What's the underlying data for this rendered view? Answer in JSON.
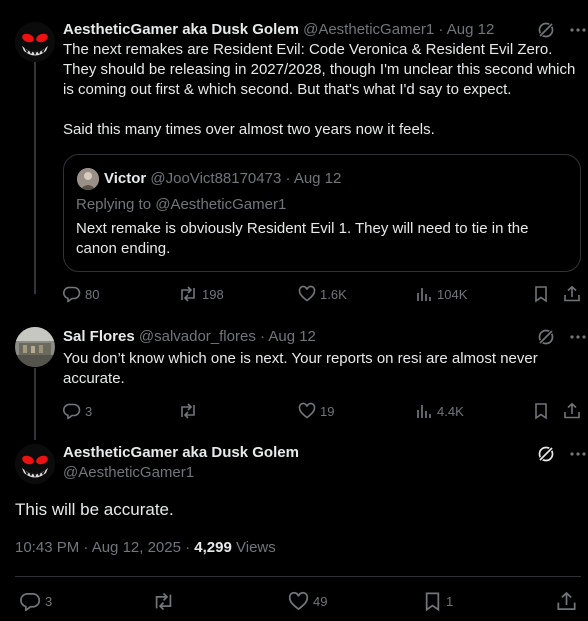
{
  "post1": {
    "author_name": "AestheticGamer aka Dusk Golem",
    "handle": "@AestheticGamer1",
    "date": "Aug 12",
    "text": "The next remakes are Resident Evil: Code Veronica & Resident Evil Zero. They should be releasing in 2027/2028, though I'm unclear this second which is coming out first & which second. But that's what I'd say to expect.\n\nSaid this many times over almost two years now it feels.",
    "quote": {
      "author_name": "Victor",
      "handle": "@JooVict88170473",
      "date": "Aug 12",
      "replying_to": "Replying to @AestheticGamer1",
      "text": "Next remake is obviously Resident Evil 1. They will need to tie in the canon ending."
    },
    "stats": {
      "replies": "80",
      "reposts": "198",
      "likes": "1.6K",
      "views": "104K"
    }
  },
  "post2": {
    "author_name": "Sal Flores",
    "handle": "@salvador_flores",
    "date": "Aug 12",
    "text": "You don’t know which one is next. Your reports on resi are almost never accurate.",
    "stats": {
      "replies": "3",
      "reposts": "",
      "likes": "19",
      "views": "4.4K"
    }
  },
  "main": {
    "author_name": "AestheticGamer aka Dusk Golem",
    "handle": "@AestheticGamer1",
    "text": "This will be accurate.",
    "time": "10:43 PM · Aug 12, 2025 · ",
    "views_count": "4,299",
    "views_label": " Views",
    "stats": {
      "replies": "3",
      "reposts": "",
      "likes": "49",
      "bookmarks": "1"
    }
  },
  "separator": " · ",
  "colors": {
    "background": "#000000",
    "text": "#e7e9ea",
    "muted": "#71767b",
    "border": "#2f3336"
  },
  "icons": [
    "grok-icon",
    "more-icon",
    "reply-icon",
    "repost-icon",
    "like-icon",
    "views-icon",
    "bookmark-icon",
    "share-icon"
  ]
}
